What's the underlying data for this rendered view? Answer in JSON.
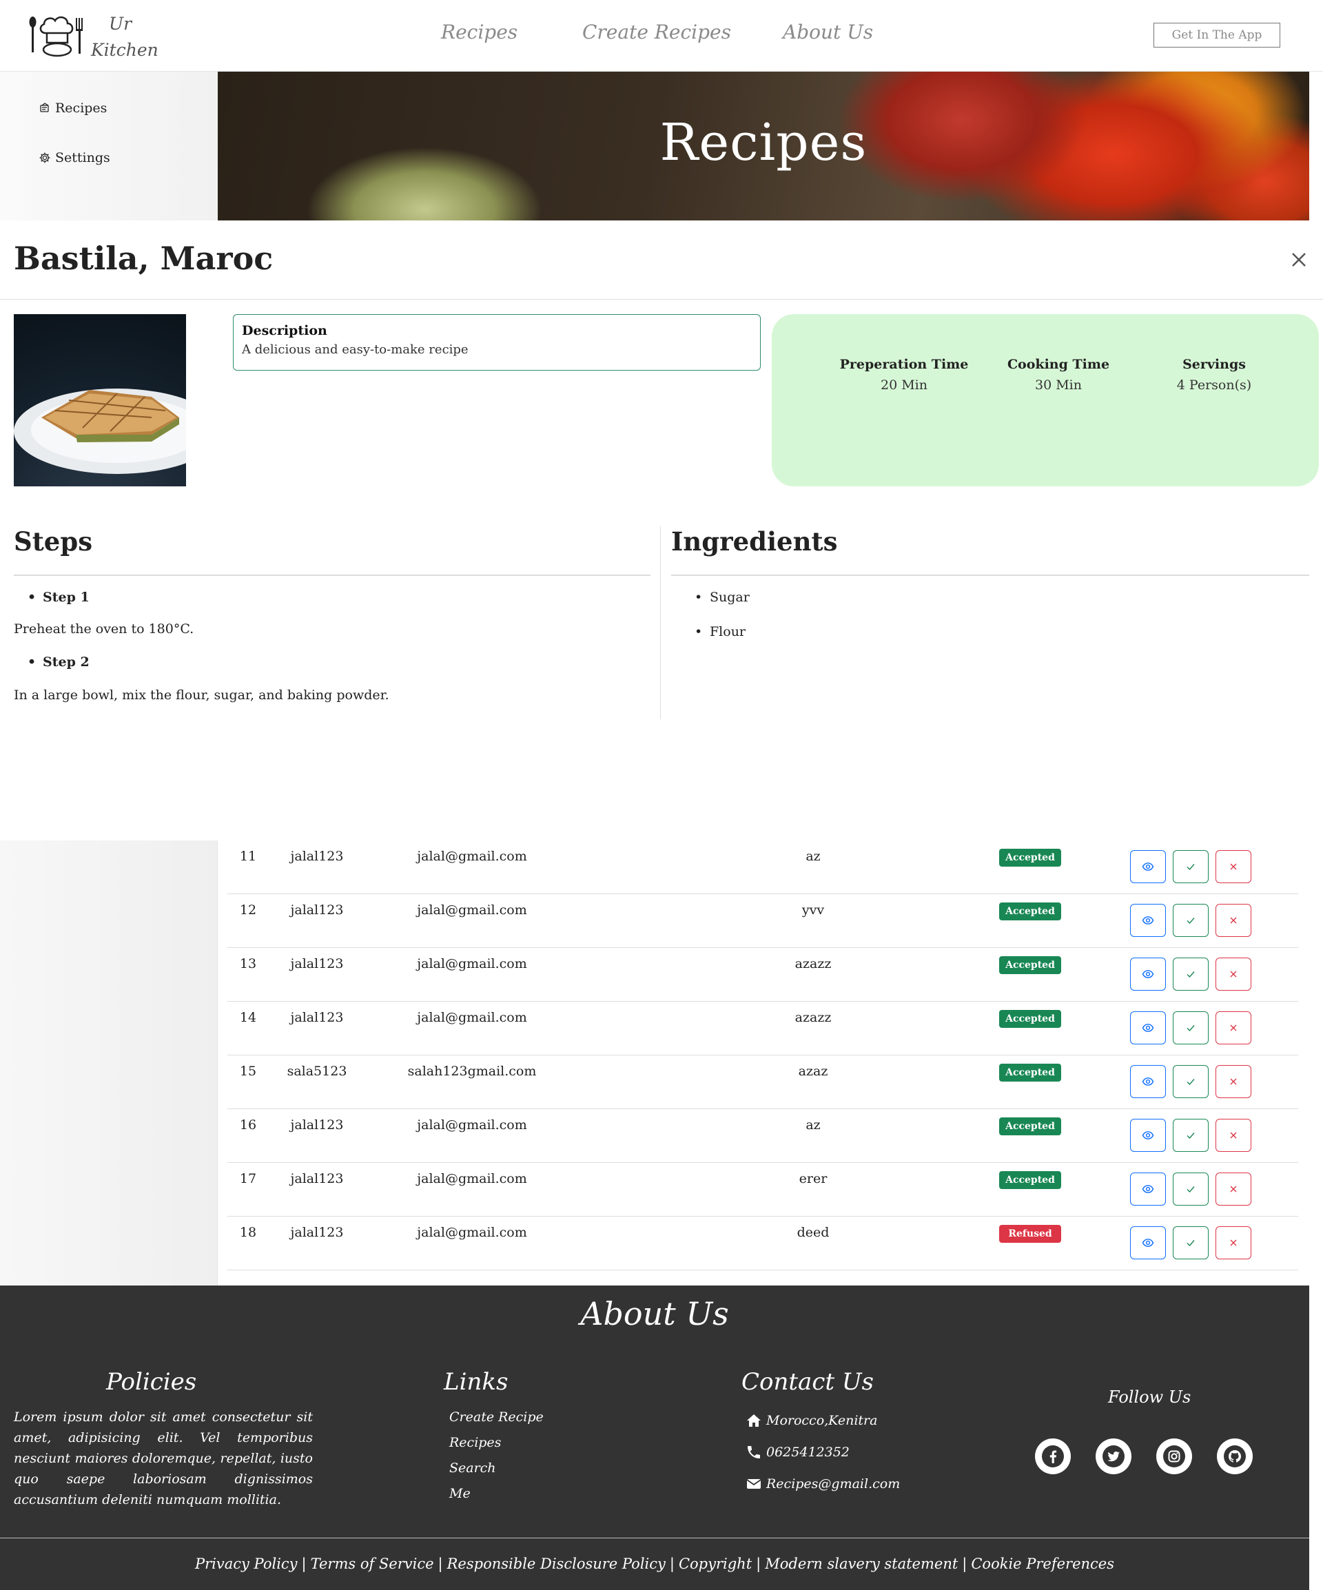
{
  "brand": {
    "line1": "Ur",
    "line2": "Kitchen"
  },
  "nav": {
    "recipes": "Recipes",
    "create": "Create Recipes",
    "about": "About Us",
    "get_app": "Get In The App"
  },
  "sidebar": {
    "items": [
      {
        "label": "Recipes",
        "icon": "recipe-book-icon"
      },
      {
        "label": "Settings",
        "icon": "gear-icon"
      }
    ]
  },
  "hero": {
    "title": "Recipes"
  },
  "modal": {
    "title": "Bastila, Maroc",
    "description": {
      "label": "Description",
      "text": "A delicious and easy-to-make recipe"
    },
    "info": [
      {
        "label": "Preperation Time",
        "value": "20 Min"
      },
      {
        "label": "Cooking Time",
        "value": "30 Min"
      },
      {
        "label": "Servings",
        "value": "4 Person(s)"
      }
    ],
    "steps_title": "Steps",
    "steps": [
      {
        "label": "Step 1",
        "text": "Preheat the oven to 180°C."
      },
      {
        "label": "Step 2",
        "text": "In a large bowl, mix the flour, sugar, and baking powder."
      }
    ],
    "ingredients_title": "Ingredients",
    "ingredients": [
      "Sugar",
      "Flour"
    ]
  },
  "table": {
    "rows": [
      {
        "id": "11",
        "user": "jalal123",
        "email": "jalal@gmail.com",
        "recipe": "az",
        "status": "Accepted"
      },
      {
        "id": "12",
        "user": "jalal123",
        "email": "jalal@gmail.com",
        "recipe": "yvv",
        "status": "Accepted"
      },
      {
        "id": "13",
        "user": "jalal123",
        "email": "jalal@gmail.com",
        "recipe": "azazz",
        "status": "Accepted"
      },
      {
        "id": "14",
        "user": "jalal123",
        "email": "jalal@gmail.com",
        "recipe": "azazz",
        "status": "Accepted"
      },
      {
        "id": "15",
        "user": "sala5123",
        "email": "salah123gmail.com",
        "recipe": "azaz",
        "status": "Accepted"
      },
      {
        "id": "16",
        "user": "jalal123",
        "email": "jalal@gmail.com",
        "recipe": "az",
        "status": "Accepted"
      },
      {
        "id": "17",
        "user": "jalal123",
        "email": "jalal@gmail.com",
        "recipe": "erer",
        "status": "Accepted"
      },
      {
        "id": "18",
        "user": "jalal123",
        "email": "jalal@gmail.com",
        "recipe": "deed",
        "status": "Refused"
      }
    ]
  },
  "footer": {
    "about": "About Us",
    "policies_title": "Policies",
    "policies_text": "Lorem ipsum dolor sit amet consectetur sit amet, adipisicing elit. Vel temporibus nesciunt maiores doloremque, repellat, iusto quo saepe laboriosam dignissimos accusantium deleniti numquam mollitia.",
    "links_title": "Links",
    "links": [
      "Create Recipe",
      "Recipes",
      "Search",
      "Me"
    ],
    "contact_title": "Contact Us",
    "contact": {
      "address": "Morocco,Kenitra",
      "phone": "0625412352",
      "email": "Recipes@gmail.com"
    },
    "follow": "Follow Us",
    "social": [
      "facebook-icon",
      "twitter-icon",
      "instagram-icon",
      "github-icon"
    ],
    "legal": [
      "Privacy Policy",
      "Terms of Service",
      "Responsible Disclosure Policy",
      "Copyright",
      "Modern slavery statement",
      "Cookie Preferences"
    ]
  },
  "colors": {
    "accepted": "#198754",
    "refused": "#dc3545",
    "view": "#0d6efd",
    "info_card": "#d6f7d6",
    "footer": "#333333"
  }
}
